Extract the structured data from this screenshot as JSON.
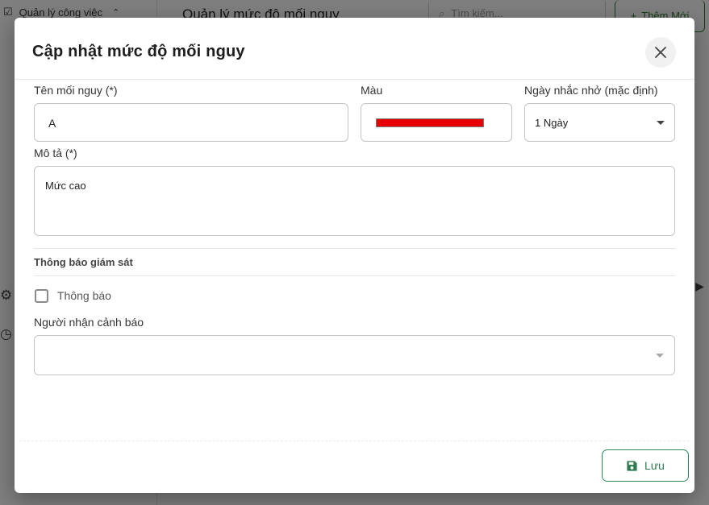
{
  "background": {
    "nav_item_label": "Quản lý công việc",
    "page_title": "Quản lý mức độ mối nguy",
    "search_placeholder": "Tìm kiếm...",
    "add_button_label": "Thêm Mới"
  },
  "modal": {
    "title": "Cập nhật mức độ mối nguy",
    "fields": {
      "name": {
        "label": "Tên mối nguy (*)",
        "value": "A"
      },
      "color": {
        "label": "Màu",
        "value": "#e60000"
      },
      "reminder": {
        "label": "Ngày nhắc nhở (mặc định)",
        "value": "1 Ngày"
      },
      "description": {
        "label": "Mô tả (*)",
        "value": "Mức cao"
      }
    },
    "monitoring": {
      "section_title": "Thông báo giám sát",
      "notify_label": "Thông báo",
      "notify_checked": false,
      "recipients_label": "Người nhận cảnh báo",
      "recipients_value": ""
    },
    "save_label": "Lưu"
  },
  "colors": {
    "accent_green": "#2e7d4f",
    "overlay": "rgba(0,0,0,0.5)"
  },
  "icons": [
    "close-icon",
    "save-icon",
    "chevron-down-icon",
    "search-icon",
    "plus-icon",
    "settings-icon",
    "history-icon"
  ]
}
